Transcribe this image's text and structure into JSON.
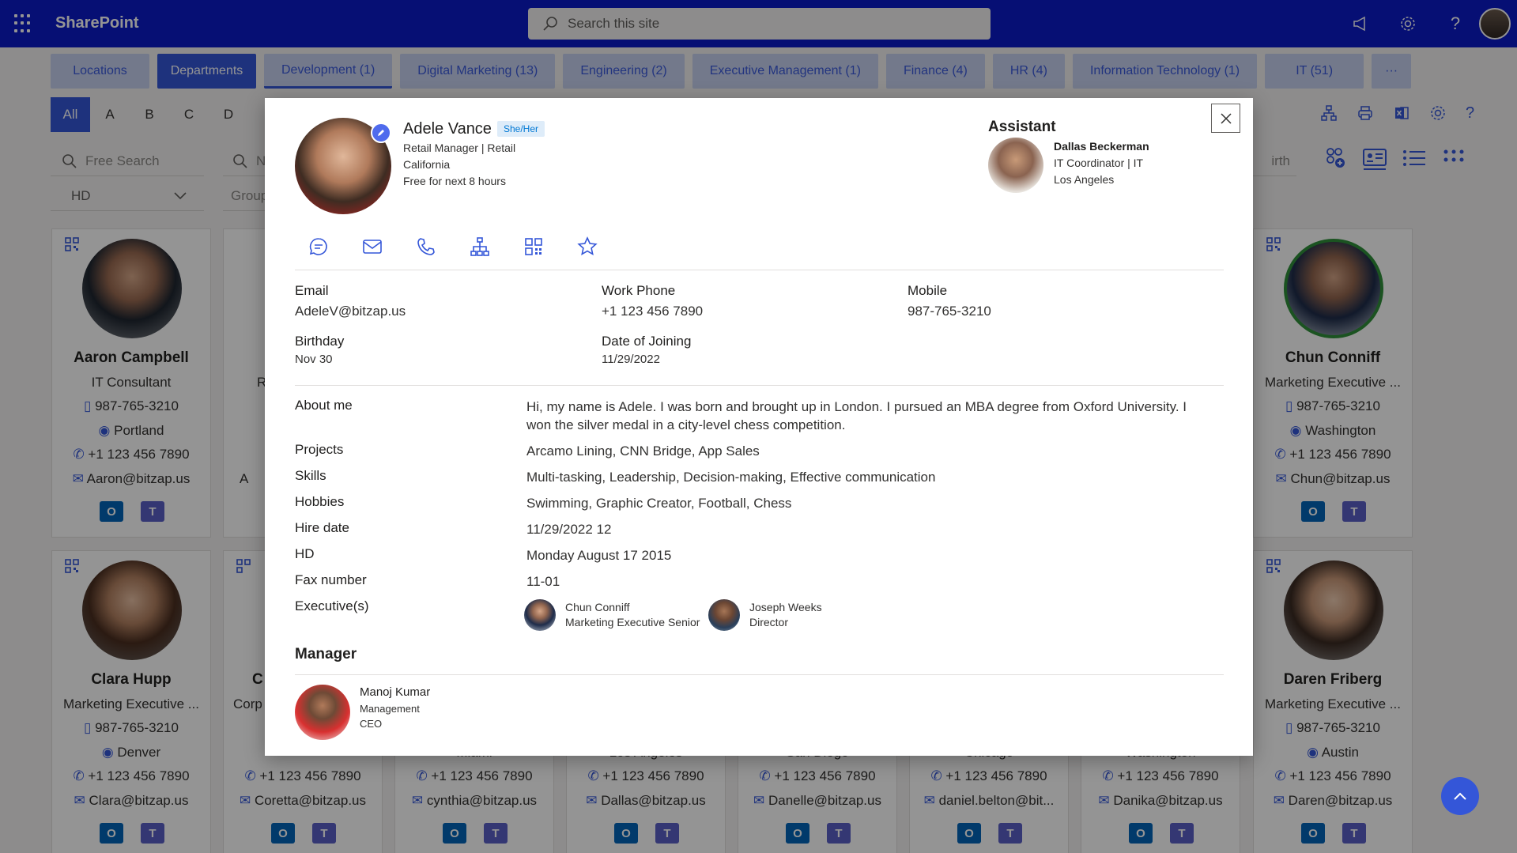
{
  "app": {
    "title": "SharePoint",
    "search_placeholder": "Search this site"
  },
  "tabs": [
    {
      "label": "Locations"
    },
    {
      "label": "Departments"
    },
    {
      "label": "Development (1)"
    },
    {
      "label": "Digital Marketing (13)"
    },
    {
      "label": "Engineering (2)"
    },
    {
      "label": "Executive Management (1)"
    },
    {
      "label": "Finance (4)"
    },
    {
      "label": "HR (4)"
    },
    {
      "label": "Information Technology (1)"
    },
    {
      "label": "IT (51)"
    },
    {
      "label": "···"
    }
  ],
  "alphabet": [
    "All",
    "A",
    "B",
    "C",
    "D"
  ],
  "filters": {
    "free_search": "Free Search",
    "hd_select": "HD",
    "group_placeholder": "Group",
    "n_placeholder": "N",
    "birth_placeholder": "irth"
  },
  "cards": {
    "aaron": {
      "name": "Aaron Campbell",
      "title": "IT Consultant",
      "mobile": "987-765-3210",
      "city": "Portland",
      "phone": "+1 123 456 7890",
      "email": "Aaron@bitzap.us"
    },
    "chun": {
      "name": "Chun Conniff",
      "title": "Marketing Executive ...",
      "mobile": "987-765-3210",
      "city": "Washington",
      "phone": "+1 123 456 7890",
      "email": "Chun@bitzap.us"
    },
    "clara": {
      "name": "Clara Hupp",
      "title": "Marketing Executive ...",
      "mobile": "987-765-3210",
      "city": "Denver",
      "phone": "+1 123 456 7890",
      "email": "Clara@bitzap.us"
    },
    "daren": {
      "name": "Daren Friberg",
      "title": "Marketing Executive ...",
      "mobile": "987-765-3210",
      "city": "Austin",
      "phone": "+1 123 456 7890",
      "email": "Daren@bitzap.us"
    },
    "coretta": {
      "phone": "+1 123 456 7890",
      "email": "Coretta@bitzap.us",
      "partial_name": "C",
      "partial_title": "Corp"
    },
    "cynthia": {
      "phone": "+1 123 456 7890",
      "email": "cynthia@bitzap.us",
      "partial_city": "Miami"
    },
    "dallas": {
      "phone": "+1 123 456 7890",
      "email": "Dallas@bitzap.us",
      "partial_city": "Los Angeles"
    },
    "danelle": {
      "phone": "+1 123 456 7890",
      "email": "Danelle@bitzap.us",
      "partial_city": "San Diego"
    },
    "daniel": {
      "phone": "+1 123 456 7890",
      "email": "daniel.belton@bit...",
      "partial_city": "Chicago"
    },
    "danika": {
      "phone": "+1 123 456 7890",
      "email": "Danika@bitzap.us",
      "partial_city": "Washington"
    },
    "row1_col2": {
      "partial_title": "R",
      "partial_email": "A"
    }
  },
  "profile": {
    "name": "Adele Vance",
    "pronouns": "She/Her",
    "role": "Retail Manager | Retail",
    "location": "California",
    "availability": "Free for next 8 hours",
    "assistant": {
      "heading": "Assistant",
      "name": "Dallas Beckerman",
      "role": "IT Coordinator | IT",
      "location": "Los Angeles"
    },
    "contact": {
      "email_label": "Email",
      "email": "AdeleV@bitzap.us",
      "work_phone_label": "Work Phone",
      "work_phone": "+1 123 456 7890",
      "mobile_label": "Mobile",
      "mobile": "987-765-3210",
      "birthday_label": "Birthday",
      "birthday": "Nov 30",
      "doj_label": "Date of Joining",
      "doj": "11/29/2022"
    },
    "details": {
      "about_label": "About me",
      "about": "Hi, my name is Adele. I was born and brought up in London. I pursued an MBA degree from Oxford University. I won the silver medal in a city-level chess competition.",
      "projects_label": "Projects",
      "projects": "Arcamo Lining, CNN Bridge, App Sales",
      "skills_label": "Skills",
      "skills": "Multi-tasking, Leadership, Decision-making, Effective communication",
      "hobbies_label": "Hobbies",
      "hobbies": "Swimming, Graphic Creator, Football, Chess",
      "hire_label": "Hire date",
      "hire": "11/29/2022 12",
      "hd_label": "HD",
      "hd": "Monday August 17 2015",
      "fax_label": "Fax number",
      "fax": "11-01",
      "exec_label": "Executive(s)"
    },
    "executives": [
      {
        "name": "Chun Conniff",
        "title": "Marketing Executive Senior"
      },
      {
        "name": "Joseph Weeks",
        "title": "Director"
      }
    ],
    "manager": {
      "heading": "Manager",
      "name": "Manoj Kumar",
      "dept": "Management",
      "title": "CEO"
    }
  },
  "colors": {
    "brand": "#0c1ac9",
    "accent": "#3456d8"
  }
}
